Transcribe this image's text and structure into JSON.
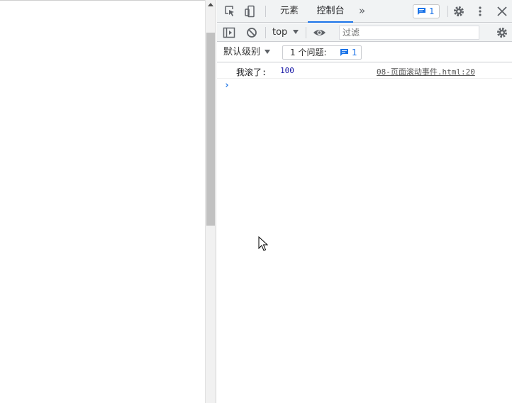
{
  "devtools": {
    "tabs": [
      {
        "label": "元素",
        "active": false
      },
      {
        "label": "控制台",
        "active": true
      }
    ],
    "more_tabs": "»",
    "issue_badge_count": "1"
  },
  "console_toolbar": {
    "context": "top",
    "filter_placeholder": "过滤",
    "default_levels": "默认级别",
    "issues_label": "1 个问题:",
    "issues_count": "1"
  },
  "console": {
    "messages": [
      {
        "text": "我滚了:",
        "value": "100",
        "source": "08-页面滚动事件.html:20"
      }
    ],
    "prompt": "›"
  },
  "colors": {
    "accent": "#1a73e8",
    "toolbar_bg": "#f1f3f4",
    "number": "#1a1aa6"
  },
  "icons": [
    "inspect-element-icon",
    "device-toolbar-icon",
    "issues-chat-icon",
    "gear-icon",
    "kebab-menu-icon",
    "close-icon",
    "sidebar-toggle-icon",
    "clear-console-icon",
    "eye-icon",
    "mouse-cursor-icon"
  ]
}
